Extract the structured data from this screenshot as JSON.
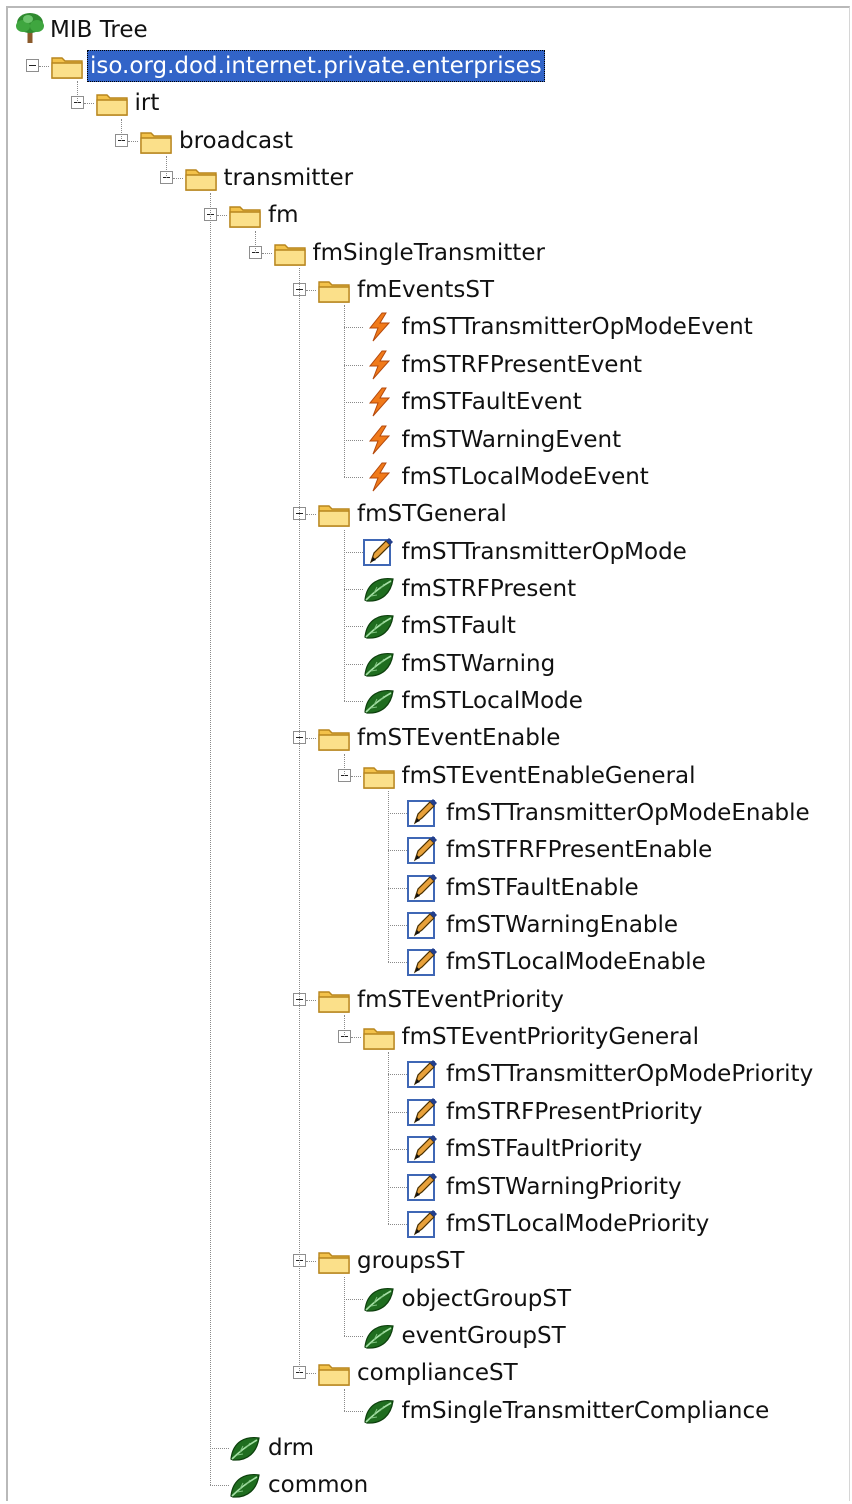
{
  "title": "MIB Tree",
  "tree": {
    "label": "iso.org.dod.internet.private.enterprises",
    "icon": "folder-icon",
    "selected": true,
    "children": [
      {
        "label": "irt",
        "icon": "folder-icon",
        "children": [
          {
            "label": "broadcast",
            "icon": "folder-icon",
            "children": [
              {
                "label": "transmitter",
                "icon": "folder-icon",
                "children": [
                  {
                    "label": "fm",
                    "icon": "folder-icon",
                    "children": [
                      {
                        "label": "fmSingleTransmitter",
                        "icon": "folder-icon",
                        "children": [
                          {
                            "label": "fmEventsST",
                            "icon": "folder-icon",
                            "children": [
                              {
                                "label": "fmSTTransmitterOpModeEvent",
                                "icon": "notification-bolt-icon"
                              },
                              {
                                "label": "fmSTRFPresentEvent",
                                "icon": "notification-bolt-icon"
                              },
                              {
                                "label": "fmSTFaultEvent",
                                "icon": "notification-bolt-icon"
                              },
                              {
                                "label": "fmSTWarningEvent",
                                "icon": "notification-bolt-icon"
                              },
                              {
                                "label": "fmSTLocalModeEvent",
                                "icon": "notification-bolt-icon"
                              }
                            ]
                          },
                          {
                            "label": "fmSTGeneral",
                            "icon": "folder-icon",
                            "children": [
                              {
                                "label": "fmSTTransmitterOpMode",
                                "icon": "writable-pen-icon"
                              },
                              {
                                "label": "fmSTRFPresent",
                                "icon": "leaf-icon"
                              },
                              {
                                "label": "fmSTFault",
                                "icon": "leaf-icon"
                              },
                              {
                                "label": "fmSTWarning",
                                "icon": "leaf-icon"
                              },
                              {
                                "label": "fmSTLocalMode",
                                "icon": "leaf-icon"
                              }
                            ]
                          },
                          {
                            "label": "fmSTEventEnable",
                            "icon": "folder-icon",
                            "children": [
                              {
                                "label": "fmSTEventEnableGeneral",
                                "icon": "folder-icon",
                                "children": [
                                  {
                                    "label": "fmSTTransmitterOpModeEnable",
                                    "icon": "writable-pen-icon"
                                  },
                                  {
                                    "label": "fmSTFRFPresentEnable",
                                    "icon": "writable-pen-icon"
                                  },
                                  {
                                    "label": "fmSTFaultEnable",
                                    "icon": "writable-pen-icon"
                                  },
                                  {
                                    "label": "fmSTWarningEnable",
                                    "icon": "writable-pen-icon"
                                  },
                                  {
                                    "label": "fmSTLocalModeEnable",
                                    "icon": "writable-pen-icon"
                                  }
                                ]
                              }
                            ]
                          },
                          {
                            "label": "fmSTEventPriority",
                            "icon": "folder-icon",
                            "children": [
                              {
                                "label": "fmSTEventPriorityGeneral",
                                "icon": "folder-icon",
                                "children": [
                                  {
                                    "label": "fmSTTransmitterOpModePriority",
                                    "icon": "writable-pen-icon"
                                  },
                                  {
                                    "label": "fmSTRFPresentPriority",
                                    "icon": "writable-pen-icon"
                                  },
                                  {
                                    "label": "fmSTFaultPriority",
                                    "icon": "writable-pen-icon"
                                  },
                                  {
                                    "label": "fmSTWarningPriority",
                                    "icon": "writable-pen-icon"
                                  },
                                  {
                                    "label": "fmSTLocalModePriority",
                                    "icon": "writable-pen-icon"
                                  }
                                ]
                              }
                            ]
                          },
                          {
                            "label": "groupsST",
                            "icon": "folder-icon",
                            "children": [
                              {
                                "label": "objectGroupST",
                                "icon": "leaf-icon"
                              },
                              {
                                "label": "eventGroupST",
                                "icon": "leaf-icon"
                              }
                            ]
                          },
                          {
                            "label": "complianceST",
                            "icon": "folder-icon",
                            "children": [
                              {
                                "label": "fmSingleTransmitterCompliance",
                                "icon": "leaf-icon"
                              }
                            ]
                          }
                        ]
                      }
                    ]
                  },
                  {
                    "label": "drm",
                    "icon": "leaf-icon"
                  },
                  {
                    "label": "common",
                    "icon": "leaf-icon"
                  }
                ]
              }
            ]
          }
        ]
      }
    ]
  }
}
